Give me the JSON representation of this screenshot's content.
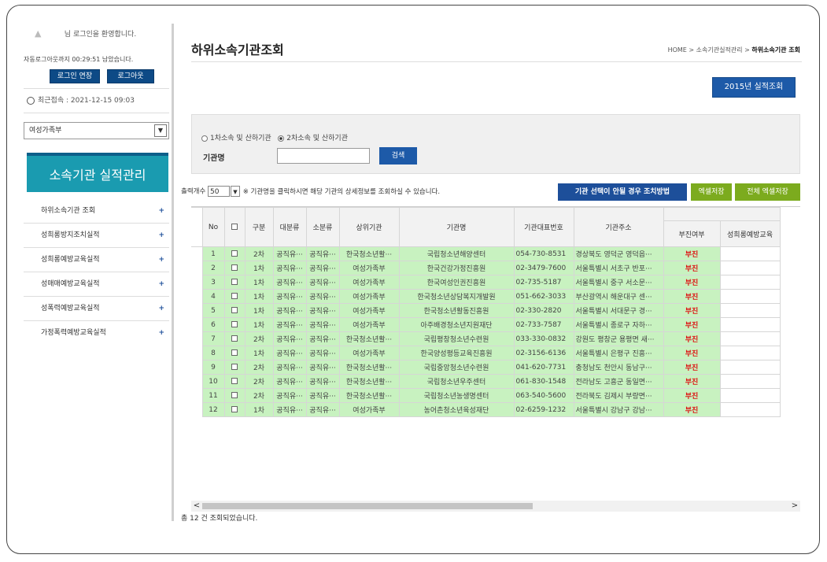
{
  "sidebar": {
    "welcome": "님 로그인을 환영합니다.",
    "auto_logout": "자동로그아웃까지 00:29:51 남았습니다.",
    "extend_label": "로그인 연장",
    "logout_label": "로그아웃",
    "last_access": "최근접속 : 2021-12-15 09:03",
    "org_select": "여성가족부",
    "banner": "소속기관 실적관리",
    "menu": [
      "하위소속기관 조회",
      "성희롱방지조치실적",
      "성희롱예방교육실적",
      "성매매예방교육실적",
      "성폭력예방교육실적",
      "가정폭력예방교육실적"
    ]
  },
  "header": {
    "title": "하위소속기관조회",
    "breadcrumb_prefix": "HOME > 소속기관실적관리 > ",
    "breadcrumb_current": "하위소속기관 조회",
    "year_button": "2015년 실적조회"
  },
  "search": {
    "radio1": "1차소속 및 산하기관",
    "radio2": "2차소속 및 산하기관",
    "org_label": "기관명",
    "search_button": "검색"
  },
  "toolbar": {
    "count_label": "출력개수",
    "count_value": "50",
    "hint": "※ 기관명을 클릭하시면 해당 기관의 상세정보를 조회하실 수 있습니다.",
    "guide_button": "기관 선택이 안될 경우 조치방법",
    "excel_button": "엑셀저장",
    "excel_all_button": "전체 엑셀저장"
  },
  "table": {
    "headers": {
      "no": "No",
      "type": "구분",
      "major": "대분류",
      "minor": "소분류",
      "parent": "상위기관",
      "name": "기관명",
      "phone": "기관대표번호",
      "address": "기관주소",
      "status": "부진여부",
      "edu": "성희롱예방교육"
    },
    "rows": [
      {
        "no": "1",
        "type": "2차",
        "major": "공직유···",
        "minor": "공직유···",
        "parent": "한국청소년활···",
        "name": "국립청소년해양센터",
        "phone": "054-730-8531",
        "address": "경상북도 영덕군 영덕읍···",
        "status": "부진"
      },
      {
        "no": "2",
        "type": "1차",
        "major": "공직유···",
        "minor": "공직유···",
        "parent": "여성가족부",
        "name": "한국건강가정진흥원",
        "phone": "02-3479-7600",
        "address": "서울특별시 서초구 반포···",
        "status": "부진"
      },
      {
        "no": "3",
        "type": "1차",
        "major": "공직유···",
        "minor": "공직유···",
        "parent": "여성가족부",
        "name": "한국여성인권진흥원",
        "phone": "02-735-5187",
        "address": "서울특별시 중구 서소문···",
        "status": "부진"
      },
      {
        "no": "4",
        "type": "1차",
        "major": "공직유···",
        "minor": "공직유···",
        "parent": "여성가족부",
        "name": "한국청소년상담복지개발원",
        "phone": "051-662-3033",
        "address": "부산광역시 해운대구 센···",
        "status": "부진"
      },
      {
        "no": "5",
        "type": "1차",
        "major": "공직유···",
        "minor": "공직유···",
        "parent": "여성가족부",
        "name": "한국청소년활동진흥원",
        "phone": "02-330-2820",
        "address": "서울특별시 서대문구 경···",
        "status": "부진"
      },
      {
        "no": "6",
        "type": "1차",
        "major": "공직유···",
        "minor": "공직유···",
        "parent": "여성가족부",
        "name": "아주배경청소년지원재단",
        "phone": "02-733-7587",
        "address": "서울특별시 종로구 자하···",
        "status": "부진"
      },
      {
        "no": "7",
        "type": "2차",
        "major": "공직유···",
        "minor": "공직유···",
        "parent": "한국청소년활···",
        "name": "국립평창청소년수련원",
        "phone": "033-330-0832",
        "address": "강원도 평창군 용평면 새···",
        "status": "부진"
      },
      {
        "no": "8",
        "type": "1차",
        "major": "공직유···",
        "minor": "공직유···",
        "parent": "여성가족부",
        "name": "한국양성평등교육진흥원",
        "phone": "02-3156-6136",
        "address": "서울특별시 은평구 진흥···",
        "status": "부진"
      },
      {
        "no": "9",
        "type": "2차",
        "major": "공직유···",
        "minor": "공직유···",
        "parent": "한국청소년활···",
        "name": "국립중앙청소년수련원",
        "phone": "041-620-7731",
        "address": "충청남도 천안시 동남구···",
        "status": "부진"
      },
      {
        "no": "10",
        "type": "2차",
        "major": "공직유···",
        "minor": "공직유···",
        "parent": "한국청소년활···",
        "name": "국립청소년우주센터",
        "phone": "061-830-1548",
        "address": "전라남도 고흥군 동일면···",
        "status": "부진"
      },
      {
        "no": "11",
        "type": "2차",
        "major": "공직유···",
        "minor": "공직유···",
        "parent": "한국청소년활···",
        "name": "국립청소년농생명센터",
        "phone": "063-540-5600",
        "address": "전라북도 김제시 부량면···",
        "status": "부진"
      },
      {
        "no": "12",
        "type": "1차",
        "major": "공직유···",
        "minor": "공직유···",
        "parent": "여성가족부",
        "name": "농어촌청소년육성재단",
        "phone": "02-6259-1232",
        "address": "서울특별시 강남구 강남···",
        "status": "부진"
      }
    ]
  },
  "footer": {
    "total": "총 12 건 조회되었습니다."
  }
}
